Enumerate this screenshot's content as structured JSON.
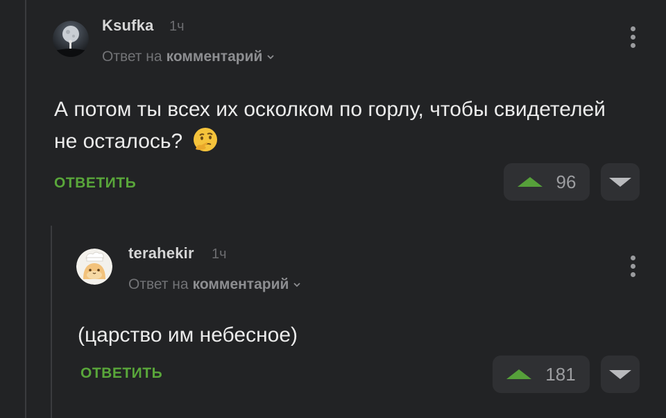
{
  "comments": [
    {
      "username": "Ksufka",
      "time": "1ч",
      "reply_prefix": "Ответ на",
      "reply_target": "комментарий",
      "text": "А потом ты всех их осколком по горлу, чтобы свидетелей не осталось?",
      "emoji": "thinking-face",
      "reply_label": "ОТВЕТИТЬ",
      "rating": "96",
      "avatar_icon": "moon-avatar"
    },
    {
      "username": "terahekir",
      "time": "1ч",
      "reply_prefix": "Ответ на",
      "reply_target": "комментарий",
      "text": "(царство им небесное)",
      "reply_label": "ОТВЕТИТЬ",
      "rating": "181",
      "avatar_icon": "chef-cat-avatar"
    }
  ],
  "colors": {
    "background": "#222325",
    "accent_green": "#59a63a",
    "vote_button_bg": "#2f3033",
    "thread_line": "#3a3b3e"
  }
}
